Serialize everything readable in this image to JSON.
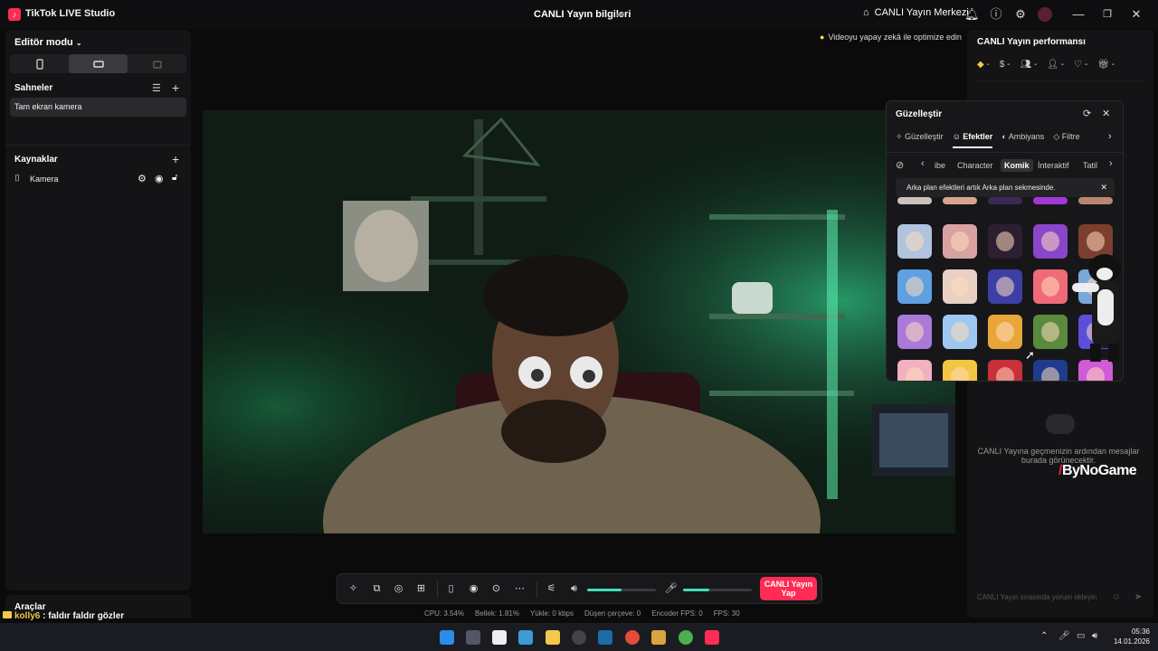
{
  "titlebar": {
    "app_title": "TikTok LIVE Studio",
    "window_title": "CANLI Yayın bilgileri",
    "live_center": "CANLI Yayın Merkezi"
  },
  "sidebar": {
    "editor_mode": "Editör modu",
    "scenes_label": "Sahneler",
    "scene_item": "Tam ekran kamera",
    "sources_label": "Kaynaklar",
    "source_item": "Kamera",
    "tools_label": "Araçlar"
  },
  "comment": {
    "user": "kolly6",
    "text": " : faldır faldır gözler"
  },
  "preview": {
    "optimize_text": "Videoyu yapay zekâ ile optimize edin"
  },
  "right_panel": {
    "perf_title": "CANLI Yayın performansı",
    "chat_empty": "CANLI Yayına geçmenizin ardından mesajlar burada görünecektir.",
    "chat_placeholder": "CANLI Yayın sırasında yorum ekleyin",
    "watermark": "ByNoGame"
  },
  "effects_panel": {
    "title": "Güzelleştir",
    "tabs": [
      "Güzelleştir",
      "Efektler",
      "Ambiyans",
      "Filtre"
    ],
    "active_tab": "Efektler",
    "categories": [
      "ibe",
      "Character",
      "Komik",
      "İnteraktif",
      "Tatil"
    ],
    "active_category": "Komik",
    "notice": "Arka plan efektleri artık Arka plan sekmesinde."
  },
  "controls": {
    "go_live": "CANLI Yayın Yap",
    "volume_level": 0.5,
    "mic_level": 0.38
  },
  "status": {
    "cpu": "CPU: 3.54%",
    "memory": "Bellek: 1.81%",
    "upload": "Yükle: 0 kbps",
    "dropped": "Düşen çerçeve: 0",
    "encoder_fps": "Encoder FPS: 0",
    "fps": "FPS: 30"
  },
  "clock": {
    "time": "05:36",
    "date": "14.01.2026"
  },
  "colors": {
    "accent": "#fe2c55",
    "slider": "#3ee0b6"
  }
}
